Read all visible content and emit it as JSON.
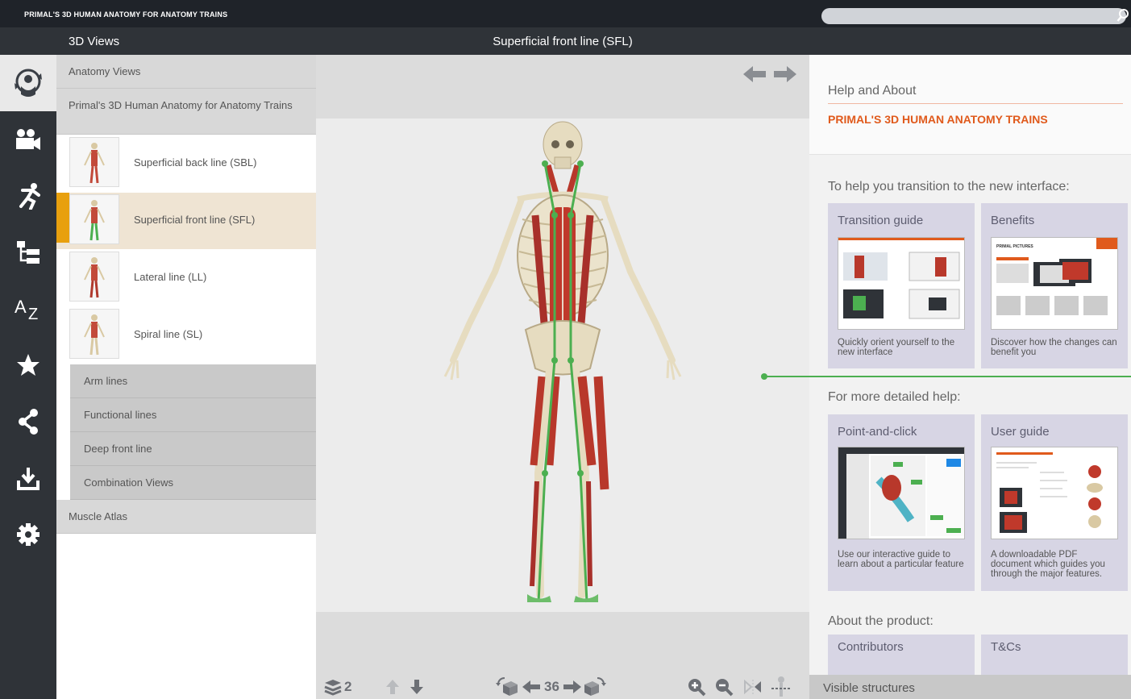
{
  "app": {
    "title": "PRIMAL'S 3D HUMAN ANATOMY FOR ANATOMY TRAINS",
    "search_placeholder": ""
  },
  "left_nav": {
    "items": [
      {
        "icon": "3d-views-icon",
        "active": true
      },
      {
        "icon": "movies-icon",
        "active": false
      },
      {
        "icon": "animation-figure-icon",
        "active": false
      },
      {
        "icon": "hierarchy-icon",
        "active": false
      },
      {
        "icon": "a-z-index-icon",
        "active": false
      },
      {
        "icon": "favorites-star-icon",
        "active": false
      },
      {
        "icon": "share-icon",
        "active": false
      },
      {
        "icon": "download-icon",
        "active": false
      },
      {
        "icon": "settings-gear-icon",
        "active": false
      }
    ]
  },
  "views_panel": {
    "title": "3D Views",
    "section_anatomy_views": "Anatomy Views",
    "section_product": "Primal's 3D Human Anatomy for Anatomy Trains",
    "thumb_items": [
      {
        "label": "Superficial back line (SBL)",
        "selected": false
      },
      {
        "label": "Superficial front line (SFL)",
        "selected": true
      },
      {
        "label": "Lateral line (LL)",
        "selected": false
      },
      {
        "label": "Spiral line (SL)",
        "selected": false
      }
    ],
    "sub_groups": [
      "Arm lines",
      "Functional lines",
      "Deep front line",
      "Combination Views"
    ],
    "section_muscle_atlas": "Muscle Atlas"
  },
  "viewer": {
    "title": "Superficial front line (SFL)",
    "layer_count": "2",
    "rotation_value": "36"
  },
  "right_panel": {
    "help_title": "Help and About",
    "help_subtitle": "PRIMAL'S 3D HUMAN ANATOMY TRAINS",
    "transition_heading": "To help you transition to the new interface:",
    "transition_tiles": [
      {
        "title": "Transition guide",
        "desc": "Quickly orient yourself to the new interface"
      },
      {
        "title": "Benefits",
        "desc": "Discover how the changes can benefit you"
      }
    ],
    "detailed_heading": "For more detailed help:",
    "detailed_tiles": [
      {
        "title": "Point-and-click",
        "desc": "Use our interactive guide to learn about a particular feature"
      },
      {
        "title": "User guide",
        "desc": "A downloadable PDF document which guides you through the major features."
      }
    ],
    "about_heading": "About the product:",
    "about_tiles": [
      {
        "title": "Contributors"
      },
      {
        "title": "T&Cs"
      }
    ],
    "benefits_doc_title": "PRIMAL PICTURES"
  },
  "visible_structures": {
    "label": "Visible structures"
  },
  "colors": {
    "accent_orange": "#e8a00e",
    "help_orange": "#e05a1c",
    "line_green": "#4caf50",
    "tile_lavender": "#d7d5e4"
  }
}
